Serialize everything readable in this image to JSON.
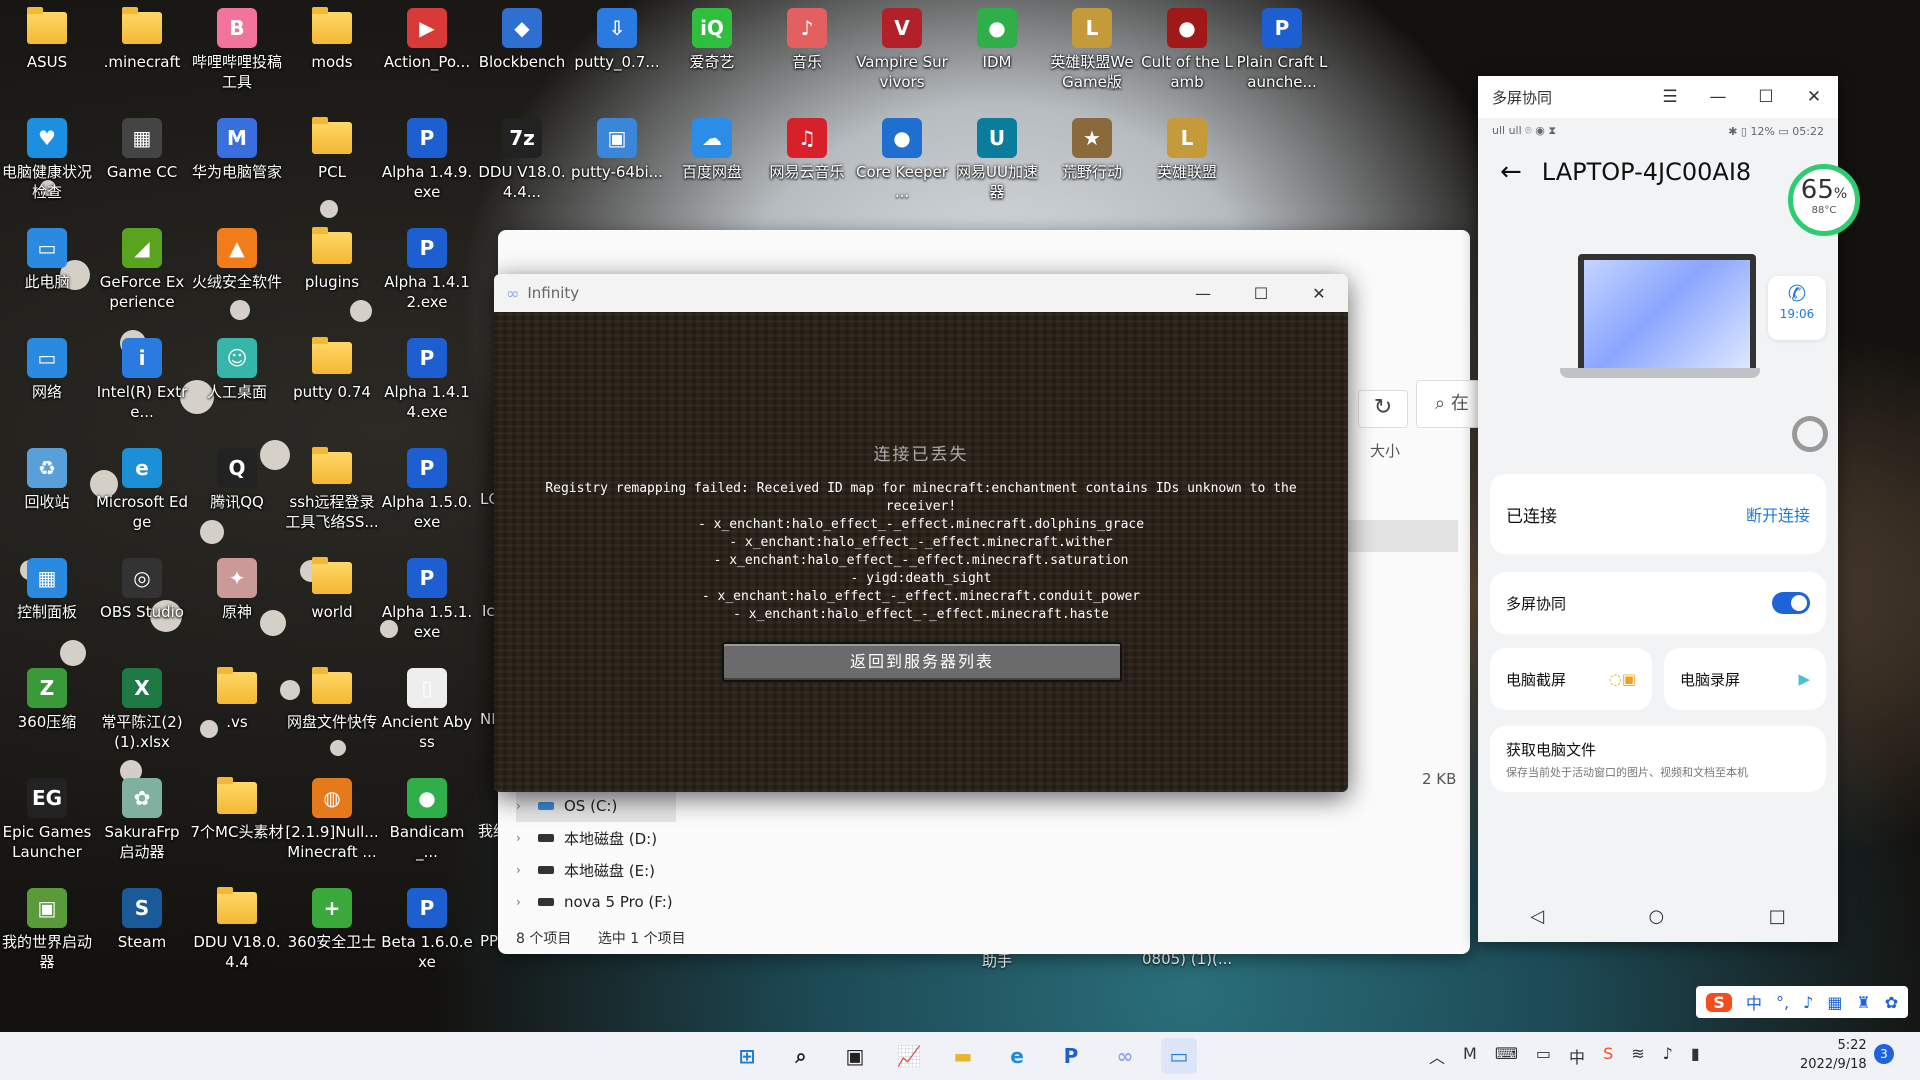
{
  "desktop": {
    "icons": [
      {
        "label": "ASUS",
        "type": "folder"
      },
      {
        "label": ".minecraft",
        "type": "folder"
      },
      {
        "label": "哔哩哔哩投稿工具",
        "type": "app",
        "glyph": "B",
        "color": "#f2739b"
      },
      {
        "label": "mods",
        "type": "folder"
      },
      {
        "label": "Action_Po...",
        "type": "app",
        "glyph": "▶",
        "color": "#d83a3a"
      },
      {
        "label": "Blockbench",
        "type": "app",
        "glyph": "◆",
        "color": "#2f6fd0"
      },
      {
        "label": "putty_0.7...",
        "type": "app",
        "glyph": "⇩",
        "color": "#2a7ae2"
      },
      {
        "label": "爱奇艺",
        "type": "app",
        "glyph": "iQ",
        "color": "#2fbf3f"
      },
      {
        "label": "音乐",
        "type": "app",
        "glyph": "♪",
        "color": "#e26060"
      },
      {
        "label": "Vampire Survivors",
        "type": "app",
        "glyph": "V",
        "color": "#b2202a"
      },
      {
        "label": "IDM",
        "type": "app",
        "glyph": "●",
        "color": "#2fae4a"
      },
      {
        "label": "英雄联盟WeGame版",
        "type": "app",
        "glyph": "L",
        "color": "#c49a3a"
      },
      {
        "label": "Cult of the Lamb",
        "type": "app",
        "glyph": "●",
        "color": "#a01818"
      },
      {
        "label": "Plain Craft Launche...",
        "type": "app",
        "glyph": "P",
        "color": "#1d5ed1"
      },
      {
        "label": "电脑健康状况检查",
        "type": "app",
        "glyph": "♥",
        "color": "#1d8fe0"
      },
      {
        "label": "Game CC",
        "type": "app",
        "glyph": "▦",
        "color": "#444"
      },
      {
        "label": "华为电脑管家",
        "type": "app",
        "glyph": "M",
        "color": "#3a6fe0"
      },
      {
        "label": "PCL",
        "type": "folder"
      },
      {
        "label": "Alpha 1.4.9.exe",
        "type": "app",
        "glyph": "P",
        "color": "#1d5ed1"
      },
      {
        "label": "DDU V18.0.4.4...",
        "type": "app",
        "glyph": "7z",
        "color": "#222"
      },
      {
        "label": "putty-64bi...",
        "type": "app",
        "glyph": "▣",
        "color": "#3a86d8"
      },
      {
        "label": "百度网盘",
        "type": "app",
        "glyph": "☁",
        "color": "#2c8de8"
      },
      {
        "label": "网易云音乐",
        "type": "app",
        "glyph": "♫",
        "color": "#d8202a"
      },
      {
        "label": "Core Keeper ...",
        "type": "app",
        "glyph": "●",
        "color": "#1f6fd0"
      },
      {
        "label": "网易UU加速器",
        "type": "app",
        "glyph": "U",
        "color": "#0a7d9c"
      },
      {
        "label": "荒野行动",
        "type": "app",
        "glyph": "★",
        "color": "#8a6a3a"
      },
      {
        "label": "英雄联盟",
        "type": "app",
        "glyph": "L",
        "color": "#c49a3a"
      },
      {
        "label": "此电脑",
        "type": "app",
        "glyph": "▭",
        "color": "#2a8ae0"
      },
      {
        "label": "GeForce Experience",
        "type": "app",
        "glyph": "◢",
        "color": "#5aa31e"
      },
      {
        "label": "火绒安全软件",
        "type": "app",
        "glyph": "▲",
        "color": "#f07c1a"
      },
      {
        "label": "plugins",
        "type": "folder"
      },
      {
        "label": "Alpha 1.4.12.exe",
        "type": "app",
        "glyph": "P",
        "color": "#1d5ed1"
      },
      {
        "label": "网络",
        "type": "app",
        "glyph": "▭",
        "color": "#2a8ae0"
      },
      {
        "label": "Intel(R) Extre...",
        "type": "app",
        "glyph": "i",
        "color": "#2a7ae2"
      },
      {
        "label": "人工桌面",
        "type": "app",
        "glyph": "☺",
        "color": "#35b6a8"
      },
      {
        "label": "putty 0.74",
        "type": "folder"
      },
      {
        "label": "Alpha 1.4.14.exe",
        "type": "app",
        "glyph": "P",
        "color": "#1d5ed1"
      },
      {
        "label": "回收站",
        "type": "app",
        "glyph": "♻",
        "color": "#5aa0d8"
      },
      {
        "label": "Microsoft Edge",
        "type": "app",
        "glyph": "e",
        "color": "#1d8fd6"
      },
      {
        "label": "腾讯QQ",
        "type": "app",
        "glyph": "Q",
        "color": "#222"
      },
      {
        "label": "ssh远程登录工具飞络SS...",
        "type": "folder"
      },
      {
        "label": "Alpha 1.5.0.exe",
        "type": "app",
        "glyph": "P",
        "color": "#1d5ed1"
      },
      {
        "label": "控制面板",
        "type": "app",
        "glyph": "▦",
        "color": "#2a8ae0"
      },
      {
        "label": "OBS Studio",
        "type": "app",
        "glyph": "◎",
        "color": "#333"
      },
      {
        "label": "原神",
        "type": "app",
        "glyph": "✦",
        "color": "#c99"
      },
      {
        "label": "world",
        "type": "folder"
      },
      {
        "label": "Alpha 1.5.1.exe",
        "type": "app",
        "glyph": "P",
        "color": "#1d5ed1"
      },
      {
        "label": "360压缩",
        "type": "app",
        "glyph": "Z",
        "color": "#3a9a3a"
      },
      {
        "label": "常平陈江(2)(1).xlsx",
        "type": "app",
        "glyph": "X",
        "color": "#1e7a45"
      },
      {
        "label": ".vs",
        "type": "folder"
      },
      {
        "label": "网盘文件快传",
        "type": "folder"
      },
      {
        "label": "Ancient Abyss",
        "type": "app",
        "glyph": "▯",
        "color": "#eee"
      },
      {
        "label": "Epic Games Launcher",
        "type": "app",
        "glyph": "EG",
        "color": "#222"
      },
      {
        "label": "SakuraFrp 启动器",
        "type": "app",
        "glyph": "✿",
        "color": "#7fb0a0"
      },
      {
        "label": "7个MC头素材",
        "type": "folder"
      },
      {
        "label": "[2.1.9]Null... Minecraft ...",
        "type": "app",
        "glyph": "◍",
        "color": "#e57a1a"
      },
      {
        "label": "Bandicam_...",
        "type": "app",
        "glyph": "●",
        "color": "#2fae4a"
      },
      {
        "label": "我的世界启动器",
        "type": "app",
        "glyph": "▣",
        "color": "#5a9a3a"
      },
      {
        "label": "Steam",
        "type": "app",
        "glyph": "S",
        "color": "#1b5a98"
      },
      {
        "label": "DDU V18.0.4.4",
        "type": "folder"
      },
      {
        "label": "360安全卫士",
        "type": "app",
        "glyph": "+",
        "color": "#3aa83a"
      },
      {
        "label": "Beta 1.6.0.exe",
        "type": "app",
        "glyph": "P",
        "color": "#1d5ed1"
      }
    ],
    "partial_labels": [
      "LC",
      "Ic 宫",
      "NI",
      "我结",
      "PP 准吾",
      "助手",
      "0805) (1)(..."
    ]
  },
  "explorer": {
    "column_size": "大小",
    "file_size": "2 KB",
    "search_placeholder": "在",
    "drives": [
      {
        "label": "OS (C:)",
        "active": true
      },
      {
        "label": "本地磁盘 (D:)",
        "active": false
      },
      {
        "label": "本地磁盘 (E:)",
        "active": false
      },
      {
        "label": "nova 5 Pro (F:)",
        "active": false
      }
    ],
    "status_items": "8 个项目",
    "status_selected": "选中 1 个项目"
  },
  "infinity": {
    "title": "Infinity",
    "disconnect_title": "连接已丢失",
    "message_lines": [
      "Registry remapping failed: Received ID map for minecraft:enchantment contains IDs unknown to the",
      "receiver!",
      "- x_enchant:halo_effect_-_effect.minecraft.dolphins_grace",
      "- x_enchant:halo_effect_-_effect.minecraft.wither",
      "- x_enchant:halo_effect_-_effect.minecraft.saturation",
      "- yigd:death_sight",
      "- x_enchant:halo_effect_-_effect.minecraft.conduit_power",
      "- x_enchant:halo_effect_-_effect.minecraft.haste"
    ],
    "back_button": "返回到服务器列表"
  },
  "multiscreen": {
    "window_title": "多屏协同",
    "statusbar_left": "ull ull ⌾ ◉ ⧗",
    "statusbar_right": "✱ ▯ 12% ▭ 05:22",
    "device_name": "LAPTOP-4JC00AI8",
    "battery_pct": "65",
    "battery_unit": "%",
    "temperature": "88°C",
    "call_time": "19:06",
    "connected_label": "已连接",
    "disconnect_label": "断开连接",
    "collab_label": "多屏协同",
    "screenshot_label": "电脑截屏",
    "record_label": "电脑录屏",
    "files_title": "获取电脑文件",
    "files_desc": "保存当前处于活动窗口的图片、视频和文档至本机"
  },
  "taskbar": {
    "apps": [
      {
        "name": "start",
        "glyph": "⊞",
        "color": "#1e7ad9"
      },
      {
        "name": "search",
        "glyph": "⌕",
        "color": "#222"
      },
      {
        "name": "taskview",
        "glyph": "▣",
        "color": "#222"
      },
      {
        "name": "chart",
        "glyph": "📈",
        "color": "#5a6a80"
      },
      {
        "name": "explorer",
        "glyph": "▬",
        "color": "#e8b52e"
      },
      {
        "name": "edge",
        "glyph": "e",
        "color": "#1d8fd6"
      },
      {
        "name": "pcl",
        "glyph": "P",
        "color": "#1d5ed1"
      },
      {
        "name": "infinity",
        "glyph": "∞",
        "color": "#8fa6ff"
      },
      {
        "name": "multiscreen",
        "glyph": "▭",
        "color": "#1e7ad9"
      }
    ],
    "time": "5:22",
    "date": "2022/9/18",
    "notifications": "3",
    "ime": [
      "中",
      "°,",
      "♪",
      "▦",
      "♜",
      "✿"
    ]
  }
}
